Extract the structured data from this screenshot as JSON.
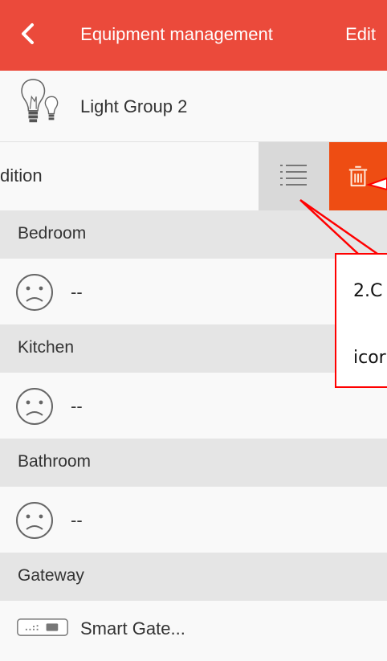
{
  "header": {
    "title": "Equipment management",
    "edit_label": "Edit"
  },
  "devices": {
    "light_group_2": "Light Group 2",
    "swiped_row_label": "dition",
    "smart_gateway": "Smart Gate..."
  },
  "sections": [
    {
      "title": "Bedroom",
      "device_label": "--"
    },
    {
      "title": "Kitchen",
      "device_label": "--"
    },
    {
      "title": "Bathroom",
      "device_label": "--"
    },
    {
      "title": "Gateway"
    }
  ],
  "annotation": {
    "line1": "2.C",
    "line2": "icor"
  },
  "colors": {
    "header": "#eb4a3b",
    "delete": "#ee4d13",
    "callout_border": "#ff0000"
  },
  "icons": {
    "back": "chevron-left-icon",
    "light": "lightbulb-icon",
    "menu": "list-icon",
    "delete": "trash-icon",
    "unknown_device": "sad-face-icon",
    "gateway": "gateway-icon"
  }
}
